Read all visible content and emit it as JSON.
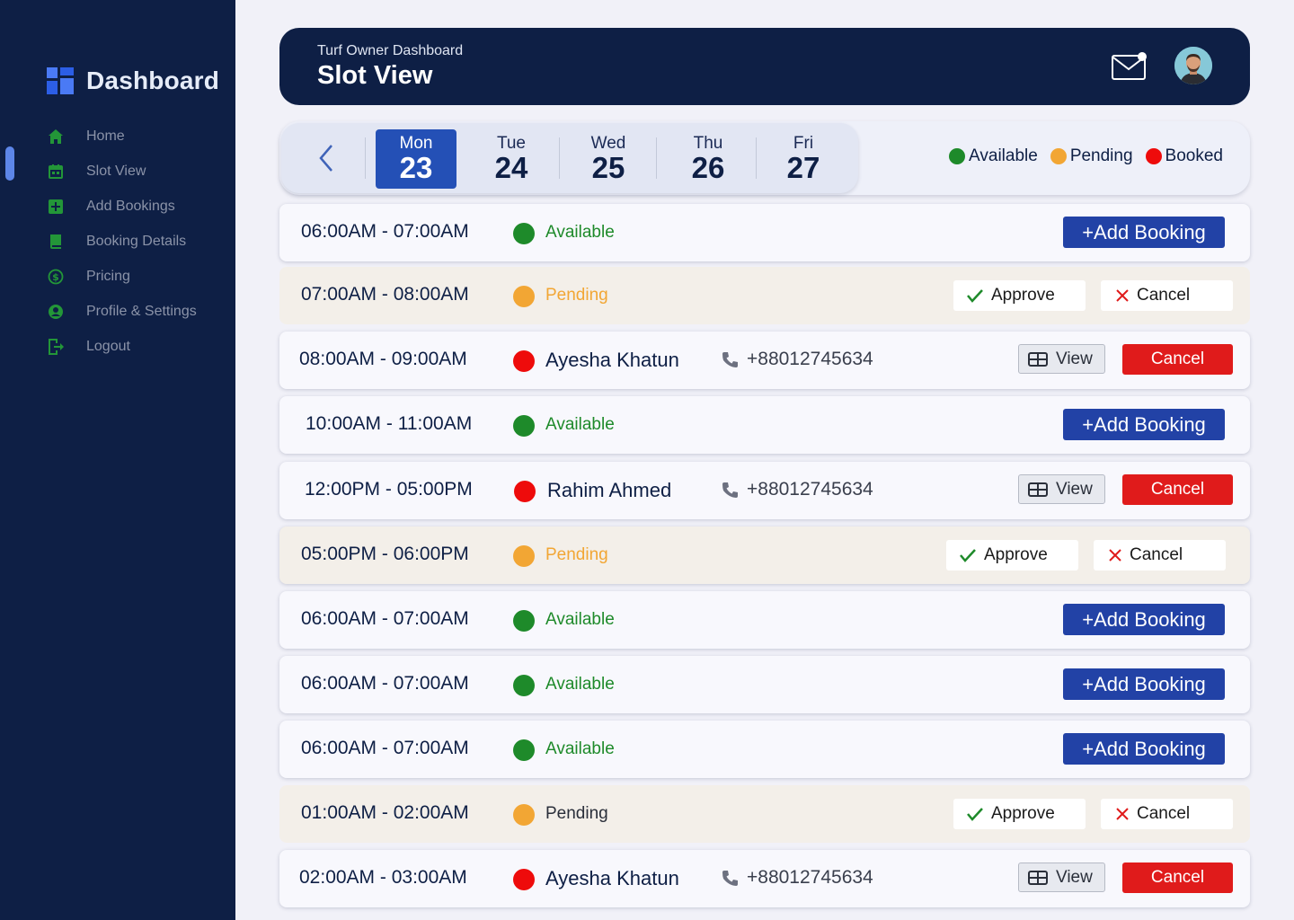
{
  "colors": {
    "sidebar_bg": "#0e1f45",
    "accent_blue": "#2242a6",
    "available": "#1e8a2a",
    "pending": "#f2a634",
    "booked": "#ee0b0b",
    "cancel_red": "#e01b1b"
  },
  "sidebar": {
    "brand": "Dashboard",
    "items": [
      {
        "label": "Home",
        "icon": "home-icon"
      },
      {
        "label": "Slot View",
        "icon": "calendar-icon"
      },
      {
        "label": "Add Bookings",
        "icon": "plus-square-icon"
      },
      {
        "label": "Booking Details",
        "icon": "book-icon"
      },
      {
        "label": "Pricing",
        "icon": "dollar-icon"
      },
      {
        "label": "Profile & Settings",
        "icon": "user-icon"
      },
      {
        "label": "Logout",
        "icon": "logout-icon"
      }
    ]
  },
  "header": {
    "subtitle": "Turf Owner Dashboard",
    "title": "Slot View",
    "has_unread_mail": true
  },
  "days": [
    {
      "name": "Mon",
      "num": "23",
      "active": true
    },
    {
      "name": "Tue",
      "num": "24",
      "active": false
    },
    {
      "name": "Wed",
      "num": "25",
      "active": false
    },
    {
      "name": "Thu",
      "num": "26",
      "active": false
    },
    {
      "name": "Fri",
      "num": "27",
      "active": false
    }
  ],
  "legend": [
    {
      "label": "Available",
      "color": "#1e8a2a"
    },
    {
      "label": "Pending",
      "color": "#f2a634"
    },
    {
      "label": "Booked",
      "color": "#ee0b0b"
    }
  ],
  "buttons": {
    "add_booking": "+Add Booking",
    "approve": "Approve",
    "cancel": "Cancel",
    "view": "View"
  },
  "slots": [
    {
      "time": "06:00AM - 07:00AM",
      "status": "available",
      "label": "Available"
    },
    {
      "time": "07:00AM - 08:00AM",
      "status": "pending",
      "label": "Pending"
    },
    {
      "time": "08:00AM - 09:00AM",
      "status": "booked",
      "name": "Ayesha Khatun",
      "phone": "+88012745634"
    },
    {
      "time": "10:00AM - 11:00AM",
      "status": "available",
      "label": "Available"
    },
    {
      "time": "12:00PM - 05:00PM",
      "status": "booked",
      "name": "Rahim Ahmed",
      "phone": "+88012745634"
    },
    {
      "time": "05:00PM - 06:00PM",
      "status": "pending",
      "label": "Pending"
    },
    {
      "time": "06:00AM - 07:00AM",
      "status": "available",
      "label": "Available"
    },
    {
      "time": "06:00AM - 07:00AM",
      "status": "available",
      "label": "Available"
    },
    {
      "time": "06:00AM - 07:00AM",
      "status": "available",
      "label": "Available"
    },
    {
      "time": "01:00AM - 02:00AM",
      "status": "pending",
      "label": "Pending"
    },
    {
      "time": "02:00AM - 03:00AM",
      "status": "booked",
      "name": "Ayesha Khatun",
      "phone": "+88012745634"
    }
  ]
}
